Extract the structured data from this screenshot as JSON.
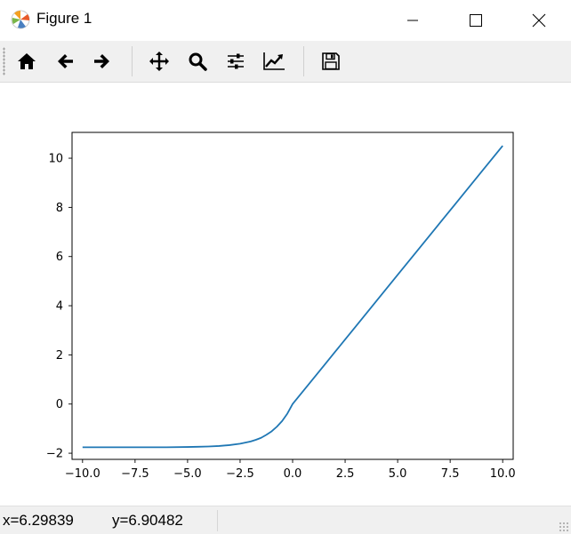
{
  "window": {
    "title": "Figure 1",
    "icon": "matplotlib-icon",
    "controls": [
      "minimize-icon",
      "maximize-icon",
      "close-icon"
    ]
  },
  "toolbar": {
    "buttons": [
      {
        "name": "home-button",
        "icon": "home-icon"
      },
      {
        "name": "back-button",
        "icon": "arrow-left-icon"
      },
      {
        "name": "forward-button",
        "icon": "arrow-right-icon"
      },
      {
        "name": "pan-button",
        "icon": "move-icon"
      },
      {
        "name": "zoom-button",
        "icon": "magnifier-icon"
      },
      {
        "name": "subplots-button",
        "icon": "sliders-icon"
      },
      {
        "name": "edit-axes-button",
        "icon": "line-chart-icon"
      },
      {
        "name": "save-button",
        "icon": "floppy-disk-icon"
      }
    ]
  },
  "status": {
    "x": "x=6.29839",
    "y": "y=6.90482"
  },
  "chart_data": {
    "type": "line",
    "title": "",
    "xlabel": "",
    "ylabel": "",
    "xlim": [
      -10.5,
      10.5
    ],
    "ylim": [
      -2.25,
      11.05
    ],
    "x_ticks": [
      -10.0,
      -7.5,
      -5.0,
      -2.5,
      0.0,
      2.5,
      5.0,
      7.5,
      10.0
    ],
    "x_tick_labels": [
      "−10.0",
      "−7.5",
      "−5.0",
      "−2.5",
      "0.0",
      "2.5",
      "5.0",
      "7.5",
      "10.0"
    ],
    "y_ticks": [
      -2,
      0,
      2,
      4,
      6,
      8,
      10
    ],
    "y_tick_labels": [
      "−2",
      "0",
      "2",
      "4",
      "6",
      "8",
      "10"
    ],
    "grid": false,
    "color": "#1f77b4",
    "series": [
      {
        "x": [
          -10,
          -9,
          -8,
          -7,
          -6,
          -5,
          -4.5,
          -4,
          -3.5,
          -3,
          -2.5,
          -2,
          -1.75,
          -1.5,
          -1.25,
          -1,
          -0.75,
          -0.5,
          -0.25,
          0,
          0.25,
          0.5,
          1,
          1.5,
          2,
          2.5,
          3,
          4,
          5,
          6,
          7,
          8,
          9,
          10
        ],
        "y": [
          -1.758,
          -1.758,
          -1.758,
          -1.758,
          -1.757,
          -1.747,
          -1.738,
          -1.726,
          -1.705,
          -1.67,
          -1.614,
          -1.521,
          -1.455,
          -1.373,
          -1.251,
          -1.111,
          -0.922,
          -0.693,
          -0.388,
          0,
          0.263,
          0.525,
          1.051,
          1.576,
          2.101,
          2.627,
          3.152,
          4.203,
          5.254,
          6.304,
          7.355,
          8.406,
          9.457,
          10.507
        ]
      }
    ]
  }
}
